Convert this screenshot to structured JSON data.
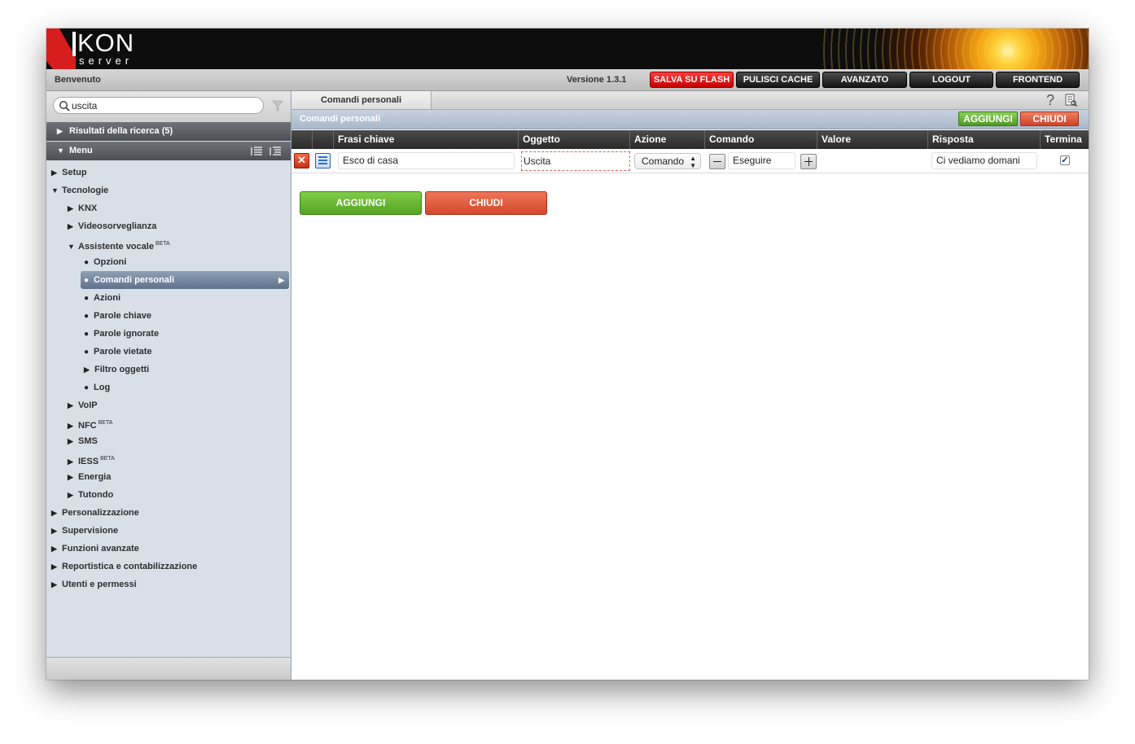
{
  "header": {
    "logo_main": "KON",
    "logo_sub": "server"
  },
  "topbar": {
    "welcome": "Benvenuto",
    "version": "Versione 1.3.1",
    "buttons": [
      "SALVA SU FLASH",
      "PULISCI CACHE",
      "AVANZATO",
      "LOGOUT",
      "FRONTEND"
    ]
  },
  "sidebar": {
    "search_value": "uscita",
    "results_label": "Risultati della ricerca (5)",
    "menu_label": "Menu",
    "tree": [
      {
        "label": "Setup",
        "marker": "▶"
      },
      {
        "label": "Tecnologie",
        "marker": "▼"
      },
      {
        "label": "KNX",
        "marker": "▶"
      },
      {
        "label": "Videosorveglianza",
        "marker": "▶"
      },
      {
        "label": "Assistente vocale",
        "marker": "▼",
        "badge": "BETA"
      },
      {
        "label": "Opzioni",
        "marker": "●"
      },
      {
        "label": "Comandi personali",
        "marker": "●",
        "selected": true
      },
      {
        "label": "Azioni",
        "marker": "●"
      },
      {
        "label": "Parole chiave",
        "marker": "●"
      },
      {
        "label": "Parole ignorate",
        "marker": "●"
      },
      {
        "label": "Parole vietate",
        "marker": "●"
      },
      {
        "label": "Filtro oggetti",
        "marker": "▶"
      },
      {
        "label": "Log",
        "marker": "●"
      },
      {
        "label": "VoIP",
        "marker": "▶"
      },
      {
        "label": "NFC",
        "marker": "▶",
        "badge": "BETA"
      },
      {
        "label": "SMS",
        "marker": "▶"
      },
      {
        "label": "IESS",
        "marker": "▶",
        "badge": "BETA"
      },
      {
        "label": "Energia",
        "marker": "▶"
      },
      {
        "label": "Tutondo",
        "marker": "▶"
      },
      {
        "label": "Personalizzazione",
        "marker": "▶"
      },
      {
        "label": "Supervisione",
        "marker": "▶"
      },
      {
        "label": "Funzioni avanzate",
        "marker": "▶"
      },
      {
        "label": "Reportistica e contabilizzazione",
        "marker": "▶"
      },
      {
        "label": "Utenti e permessi",
        "marker": "▶"
      }
    ]
  },
  "main": {
    "tab_label": "Comandi personali",
    "help_symbol": "?",
    "panel_title": "Comandi personali",
    "add_label": "AGGIUNGI",
    "close_label": "CHIUDI",
    "columns": [
      "Frasi chiave",
      "Oggetto",
      "Azione",
      "Comando",
      "Valore",
      "Risposta",
      "Termina"
    ],
    "row": {
      "frase": "Esco di casa",
      "oggetto": "Uscita",
      "azione": "Comando",
      "comando": "Eseguire",
      "valore": "",
      "risposta": "Ci vediamo domani",
      "termina": true
    }
  },
  "colors": {
    "accent_red": "#e21a1a",
    "accent_green": "#5aab28",
    "sidebar_bg": "#d8dfe6",
    "selected_item": "#6e819b"
  }
}
